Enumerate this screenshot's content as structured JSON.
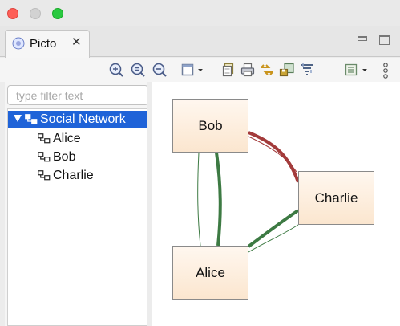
{
  "window": {
    "tab": {
      "label": "Picto",
      "close_glyph": "✕"
    }
  },
  "toolbar": {
    "icons": [
      "zoom-in-icon",
      "zoom-reset-icon",
      "zoom-out-icon",
      "layout-dropdown-icon",
      "copy-icon",
      "print-icon",
      "export-icon",
      "save-image-icon",
      "filter-icon",
      "view-menu-icon",
      "more-icon"
    ]
  },
  "sidebar": {
    "filter_placeholder": "type filter text",
    "tree": {
      "root": {
        "label": "Social Network",
        "selected": true
      },
      "children": [
        {
          "label": "Alice"
        },
        {
          "label": "Bob"
        },
        {
          "label": "Charlie"
        }
      ]
    }
  },
  "graph": {
    "nodes": [
      {
        "id": "bob",
        "label": "Bob"
      },
      {
        "id": "charlie",
        "label": "Charlie"
      },
      {
        "id": "alice",
        "label": "Alice"
      }
    ],
    "edges": [
      {
        "from": "bob",
        "to": "charlie",
        "color": "#a33b3b",
        "weight": "thick"
      },
      {
        "from": "charlie",
        "to": "bob",
        "color": "#a33b3b",
        "weight": "thin"
      },
      {
        "from": "bob",
        "to": "alice",
        "color": "#3d7a43",
        "weight": "thick"
      },
      {
        "from": "alice",
        "to": "bob",
        "color": "#3d7a43",
        "weight": "thin"
      },
      {
        "from": "charlie",
        "to": "alice",
        "color": "#3d7a43",
        "weight": "thick"
      },
      {
        "from": "alice",
        "to": "charlie",
        "color": "#3d7a43",
        "weight": "thin"
      }
    ]
  },
  "colors": {
    "selection": "#1f63d8",
    "node_fill": "#fbe6cf",
    "edge_red": "#a33b3b",
    "edge_green": "#3d7a43"
  }
}
